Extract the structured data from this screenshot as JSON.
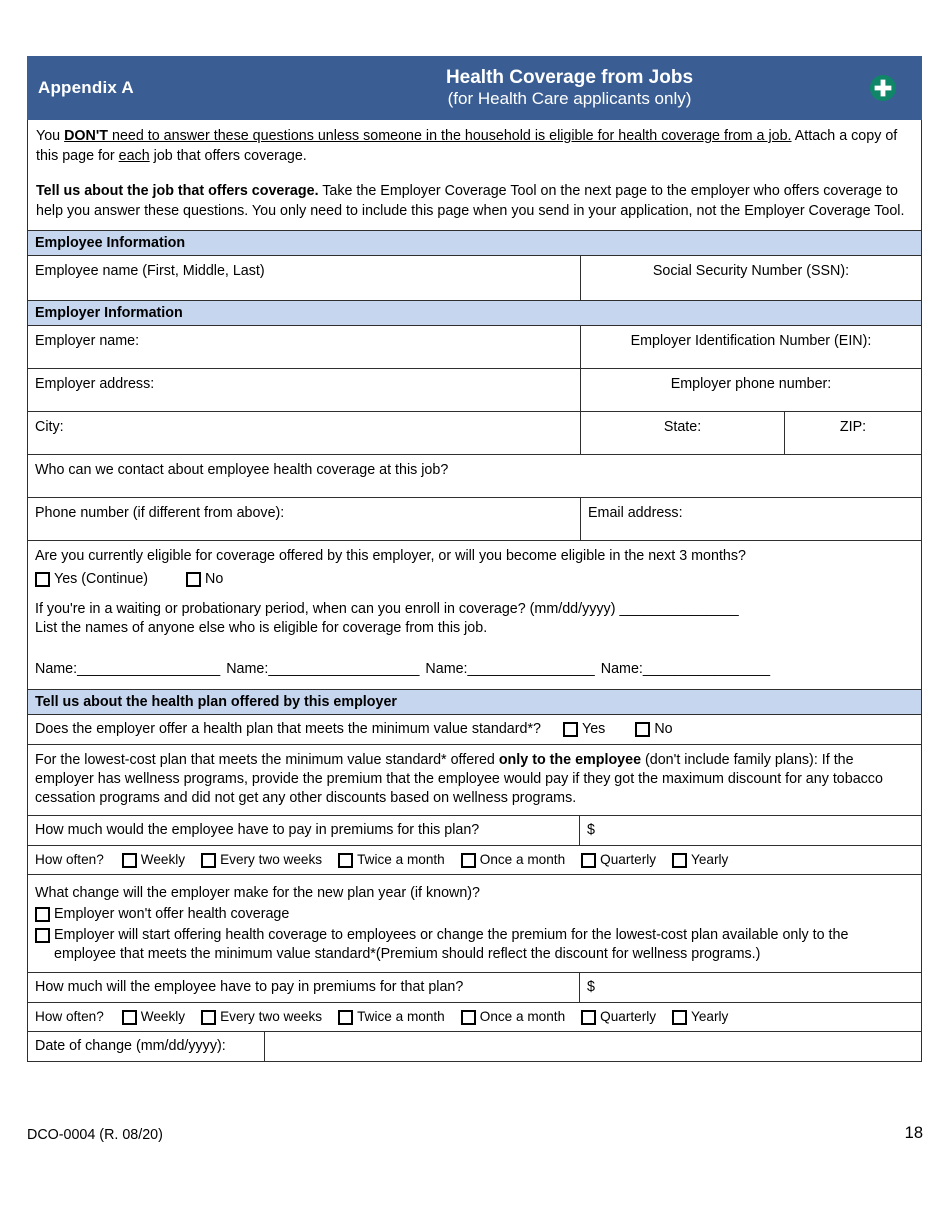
{
  "banner": {
    "appendix_label": "Appendix A",
    "title_main": "Health Coverage from Jobs",
    "title_sub": "(for Health Care applicants only)",
    "logo_icon": "medical-cross-icon",
    "bg_color": "#3A5E93",
    "logo_circle_color": "#0E8667",
    "logo_cross_color": "#FFFFFF"
  },
  "intro": {
    "p1_prefix": "You ",
    "p1_bold": "DON'T",
    "p1_underlined": " need to answer these questions unless someone in the household is eligible for health coverage from a job.",
    "p1_tail": " Attach a copy of this page for ",
    "p1_each": "each",
    "p1_end": " job that offers coverage.",
    "p2_bold": "Tell us about the job that offers coverage.",
    "p2_rest": " Take the Employer Coverage Tool on the next page to the employer who offers coverage to help you answer these questions. You only need to include this page when you send in your application, not the Employer Coverage Tool."
  },
  "employee_section": {
    "heading": "Employee Information",
    "name_label": "Employee name (First, Middle, Last)",
    "ssn_label": "Social Security Number (SSN):"
  },
  "employer_section": {
    "heading": "Employer Information",
    "employer_name_label": "Employer name:",
    "ein_label": "Employer Identification Number (EIN):",
    "address_label": "Employer address:",
    "phone_label": "Employer phone number:",
    "city_label": "City:",
    "state_label": "State:",
    "zip_label": "ZIP:"
  },
  "contact_section": {
    "contact_question": "Who can we contact about employee health coverage at this job?",
    "phone_label": "Phone number (if different from above):",
    "email_label": "Email address:"
  },
  "eligibility_section": {
    "question": "Are you currently eligible for coverage offered by this employer, or will you become eligible in the next 3 months?",
    "options": [
      {
        "label": "Yes (Continue)",
        "checked": false
      },
      {
        "label": "No",
        "checked": false
      }
    ],
    "waiting_period_text": "If you're in a waiting or probationary period, when can you enroll in coverage? (mm/dd/yyyy)",
    "waiting_period_blank": "_______________",
    "list_names_text": "List the names of anyone else who is eligible for coverage from this job.",
    "name_fields": [
      {
        "label": "Name:",
        "blank": "__________________"
      },
      {
        "label": "Name:",
        "blank": "___________________"
      },
      {
        "label": "Name:",
        "blank": "________________"
      },
      {
        "label": "Name:",
        "blank": "________________"
      }
    ]
  },
  "health_plan_section": {
    "heading": "Tell us about the health plan offered by this employer",
    "mvs_question": "Does the employer offer a health plan that meets the minimum value standard*?",
    "mvs_options": [
      {
        "label": "Yes",
        "checked": false
      },
      {
        "label": "No",
        "checked": false
      }
    ],
    "lowest_cost_line1_a": "For the lowest-cost plan that meets the minimum value standard* offered ",
    "lowest_cost_line1_bold": "only to the employee",
    "lowest_cost_line1_b": " (don't include family plans):",
    "lowest_cost_line2": "If the employer has wellness programs, provide the premium that the employee would pay if they got the maximum discount for any tobacco cessation programs and did not get any other discounts based on wellness programs.",
    "premium_question": "How much would the employee have to pay in premiums for this plan?",
    "premium_currency": "$",
    "how_often_label": "How often?",
    "how_often_options": [
      {
        "label": "Weekly",
        "checked": false
      },
      {
        "label": "Every two weeks",
        "checked": false
      },
      {
        "label": "Twice a month",
        "checked": false
      },
      {
        "label": "Once a month",
        "checked": false
      },
      {
        "label": "Quarterly",
        "checked": false
      },
      {
        "label": "Yearly",
        "checked": false
      }
    ]
  },
  "new_plan_year_section": {
    "question": "What change will the employer make for the new plan year (if known)?",
    "option1": "Employer won't offer health coverage",
    "option2": "Employer will start offering health coverage to employees or change the premium for the lowest-cost plan available only to the employee that meets the minimum value standard*(Premium should reflect the discount for wellness programs.)",
    "premium_question": "How much will the employee have to pay in premiums for that plan?",
    "premium_currency": "$",
    "how_often_label": "How often?",
    "how_often_options": [
      {
        "label": "Weekly",
        "checked": false
      },
      {
        "label": "Every two weeks",
        "checked": false
      },
      {
        "label": "Twice a month",
        "checked": false
      },
      {
        "label": "Once a month",
        "checked": false
      },
      {
        "label": "Quarterly",
        "checked": false
      },
      {
        "label": "Yearly",
        "checked": false
      }
    ],
    "date_of_change_label": "Date of change (mm/dd/yyyy):",
    "date_of_change_value": ""
  },
  "footer": {
    "form_number": "DCO-0004 (R. 08/20)",
    "page_number": "18"
  }
}
